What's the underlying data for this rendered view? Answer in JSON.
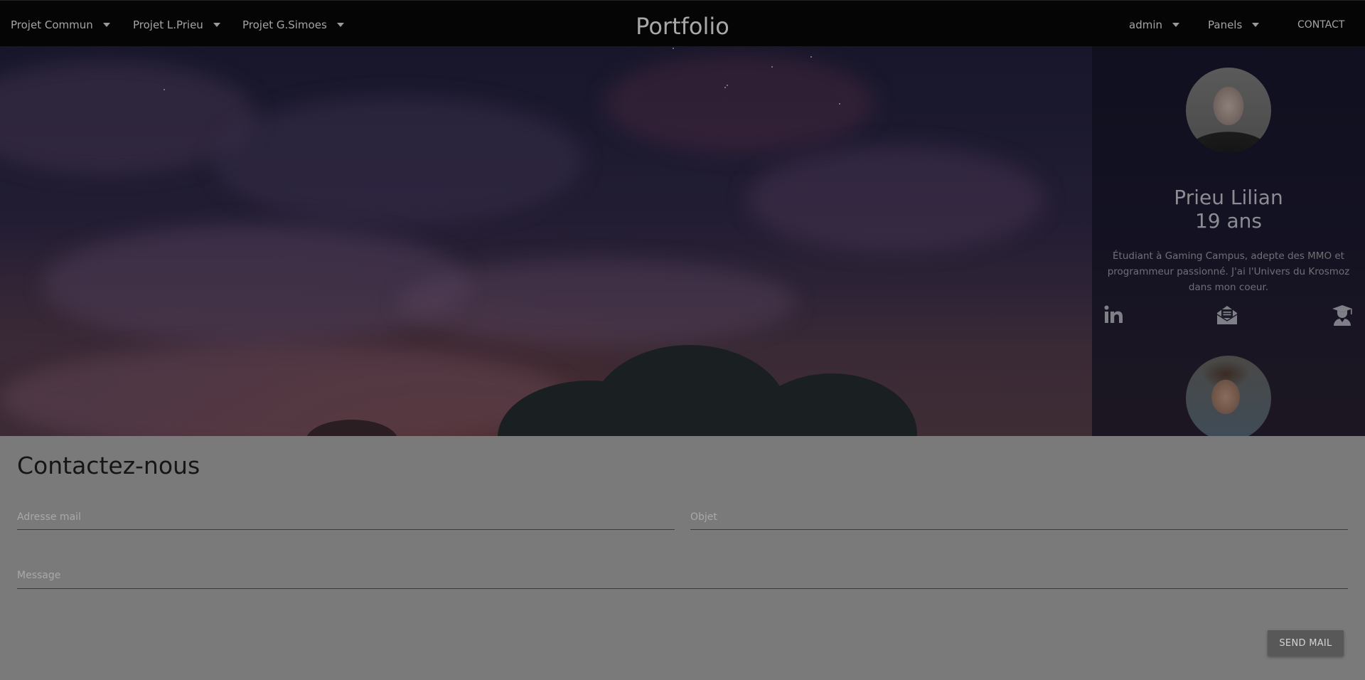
{
  "nav": {
    "left_items": [
      {
        "label": "Projet Commun"
      },
      {
        "label": "Projet L.Prieu"
      },
      {
        "label": "Projet G.Simoes"
      }
    ],
    "brand": "Portfolio",
    "right_items": [
      {
        "label": "admin"
      },
      {
        "label": "Panels"
      }
    ],
    "contact_link": "CONTACT"
  },
  "profile": {
    "name": "Prieu Lilian",
    "age": "19 ans",
    "bio": "Étudiant à Gaming Campus, adepte des MMO et programmeur passionné. J'ai l'Univers du Krosmoz dans mon coeur.",
    "social_icons": [
      "linkedin-icon",
      "envelope-open-icon",
      "graduate-icon"
    ]
  },
  "contact": {
    "title": "Contactez-nous",
    "email_placeholder": "Adresse mail",
    "email_value": "",
    "subject_placeholder": "Objet",
    "subject_value": "",
    "message_placeholder": "Message",
    "message_value": "",
    "send_label": "SEND MAIL"
  },
  "colors": {
    "navbar_bg": "#050505",
    "content_bg": "#7a7a7a",
    "button_bg": "#585858"
  }
}
